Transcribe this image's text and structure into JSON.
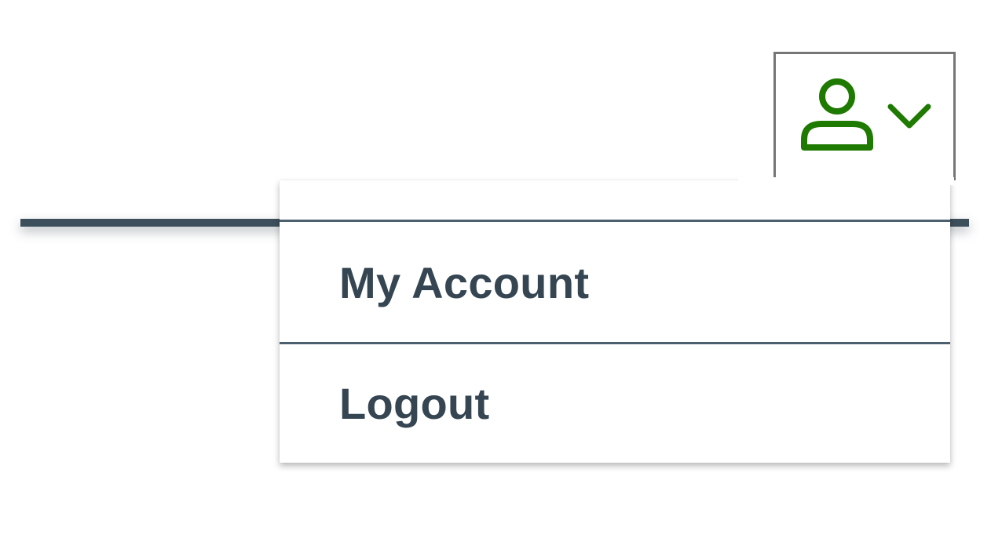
{
  "account_menu": {
    "trigger_icon": "user-icon",
    "chevron_icon": "chevron-down-icon",
    "icon_color": "#1e7a00",
    "items": [
      {
        "label": "My Account"
      },
      {
        "label": "Logout"
      }
    ]
  },
  "colors": {
    "menu_text": "#354552",
    "divider": "#4b5f6e",
    "header_bar": "#3e4f5c",
    "trigger_border": "#767676"
  }
}
